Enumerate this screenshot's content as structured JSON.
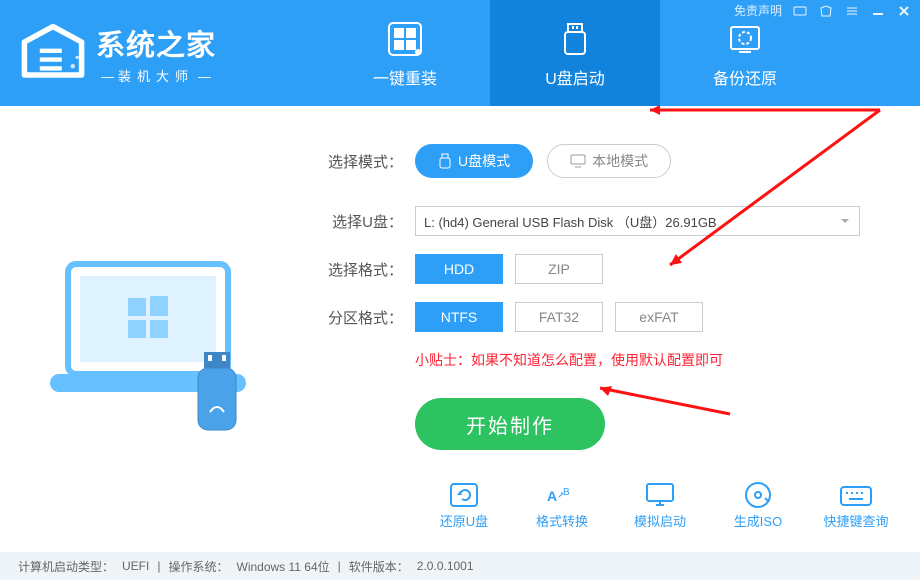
{
  "brand": {
    "title": "系统之家",
    "subtitle": "装机大师"
  },
  "titlebar": {
    "disclaimer": "免责声明"
  },
  "tabs": [
    {
      "label": "一键重装",
      "active": false
    },
    {
      "label": "U盘启动",
      "active": true
    },
    {
      "label": "备份还原",
      "active": false
    }
  ],
  "form": {
    "mode_label": "选择模式：",
    "usb_mode": "U盘模式",
    "local_mode": "本地模式",
    "usb_label": "选择U盘：",
    "usb_value": "L: (hd4) General USB Flash Disk （U盘）26.91GB",
    "format_label": "选择格式：",
    "format_options": [
      "HDD",
      "ZIP"
    ],
    "format_selected": "HDD",
    "partition_label": "分区格式：",
    "partition_options": [
      "NTFS",
      "FAT32",
      "exFAT"
    ],
    "partition_selected": "NTFS",
    "hint": "小贴士：如果不知道怎么配置，使用默认配置即可",
    "start": "开始制作"
  },
  "tools": [
    {
      "label": "还原U盘"
    },
    {
      "label": "格式转换"
    },
    {
      "label": "模拟启动"
    },
    {
      "label": "生成ISO"
    },
    {
      "label": "快捷键查询"
    }
  ],
  "footer": {
    "boot_type_label": "计算机启动类型：",
    "boot_type": "UEFI",
    "os_label": "操作系统：",
    "os": "Windows 11 64位",
    "ver_label": "软件版本：",
    "ver": "2.0.0.1001"
  }
}
